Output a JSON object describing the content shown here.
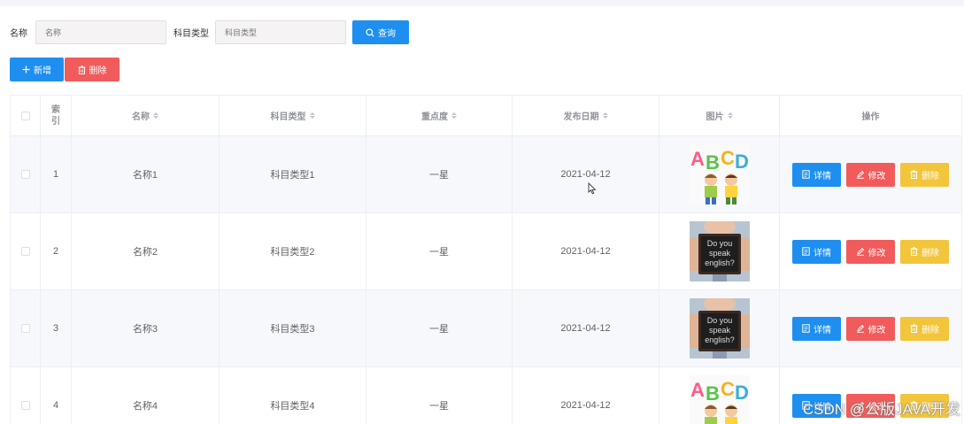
{
  "search": {
    "name_label": "名称",
    "name_placeholder": "名称",
    "type_label": "科目类型",
    "type_placeholder": "科目类型",
    "query_button": "查询"
  },
  "actions": {
    "add_button": "新增",
    "delete_button": "删除"
  },
  "table": {
    "headers": {
      "index": "索引",
      "name": "名称",
      "type": "科目类型",
      "importance": "重点度",
      "date": "发布日期",
      "image": "图片",
      "ops": "操作"
    },
    "row_buttons": {
      "detail": "详情",
      "edit": "修改",
      "delete": "删除"
    },
    "rows": [
      {
        "index": "1",
        "name": "名称1",
        "type": "科目类型1",
        "importance": "一星",
        "date": "2021-04-12",
        "image": "abcd-kids"
      },
      {
        "index": "2",
        "name": "名称2",
        "type": "科目类型2",
        "importance": "一星",
        "date": "2021-04-12",
        "image": "do-you-speak-english"
      },
      {
        "index": "3",
        "name": "名称3",
        "type": "科目类型3",
        "importance": "一星",
        "date": "2021-04-12",
        "image": "do-you-speak-english"
      },
      {
        "index": "4",
        "name": "名称4",
        "type": "科目类型4",
        "importance": "一星",
        "date": "2021-04-12",
        "image": "abcd-kids"
      }
    ]
  },
  "sign_text": {
    "line1": "Do you",
    "line2": "speak",
    "line3": "english?"
  },
  "watermark": "CSDN @公版JAVA开发",
  "colors": {
    "primary": "#1e8ff0",
    "danger": "#f25b5b",
    "warning": "#f3c53b"
  }
}
